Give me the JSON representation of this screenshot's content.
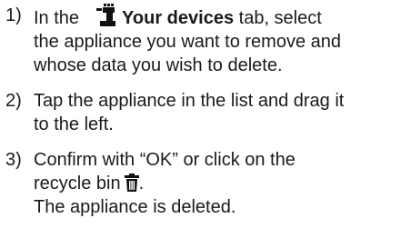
{
  "steps": [
    {
      "number": "1)",
      "prefix": "In the",
      "icon": "devices-icon",
      "bold": "Your devices",
      "line1_rest": "tab, select",
      "line2": "the appliance you want to remove and",
      "line3": "whose data you wish to delete."
    },
    {
      "number": "2)",
      "line1": "Tap the appliance in the list and drag it",
      "line2": "to the left."
    },
    {
      "number": "3)",
      "line1": "Confirm with “OK” or click on the",
      "line2": "recycle bin",
      "icon": "recycle-bin-icon",
      "line2_suffix": ".",
      "line3": "The appliance is deleted."
    }
  ]
}
